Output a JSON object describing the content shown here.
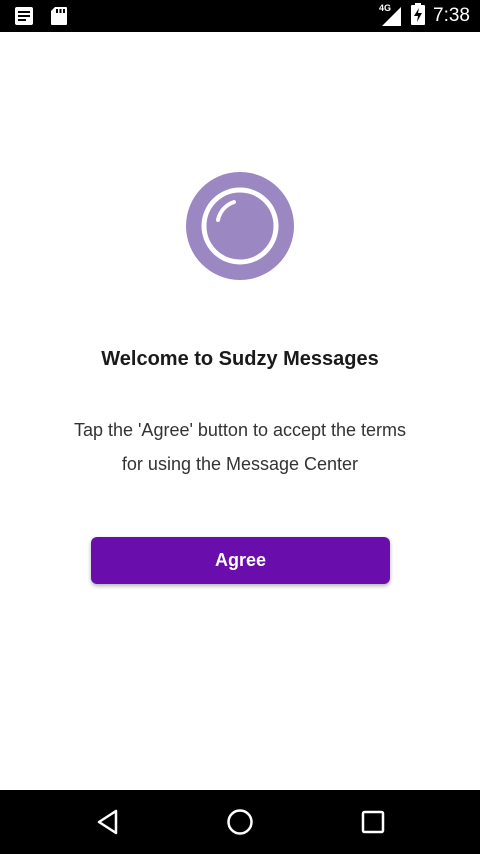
{
  "status_bar": {
    "time": "7:38",
    "network": "4G",
    "icons": [
      "notes-icon",
      "sd-card-icon",
      "signal-icon",
      "battery-charging-icon"
    ]
  },
  "welcome": {
    "title": "Welcome to Sudzy Messages",
    "description_line1": "Tap the 'Agree' button to accept the terms",
    "description_line2": "for using the Message Center",
    "agree_label": "Agree"
  },
  "navigation": {
    "icons": [
      "back-icon",
      "home-icon",
      "recents-icon"
    ]
  },
  "colors": {
    "accent": "#6a0dad",
    "logo_fill": "#9b87c2",
    "status_bar": "#000000"
  }
}
